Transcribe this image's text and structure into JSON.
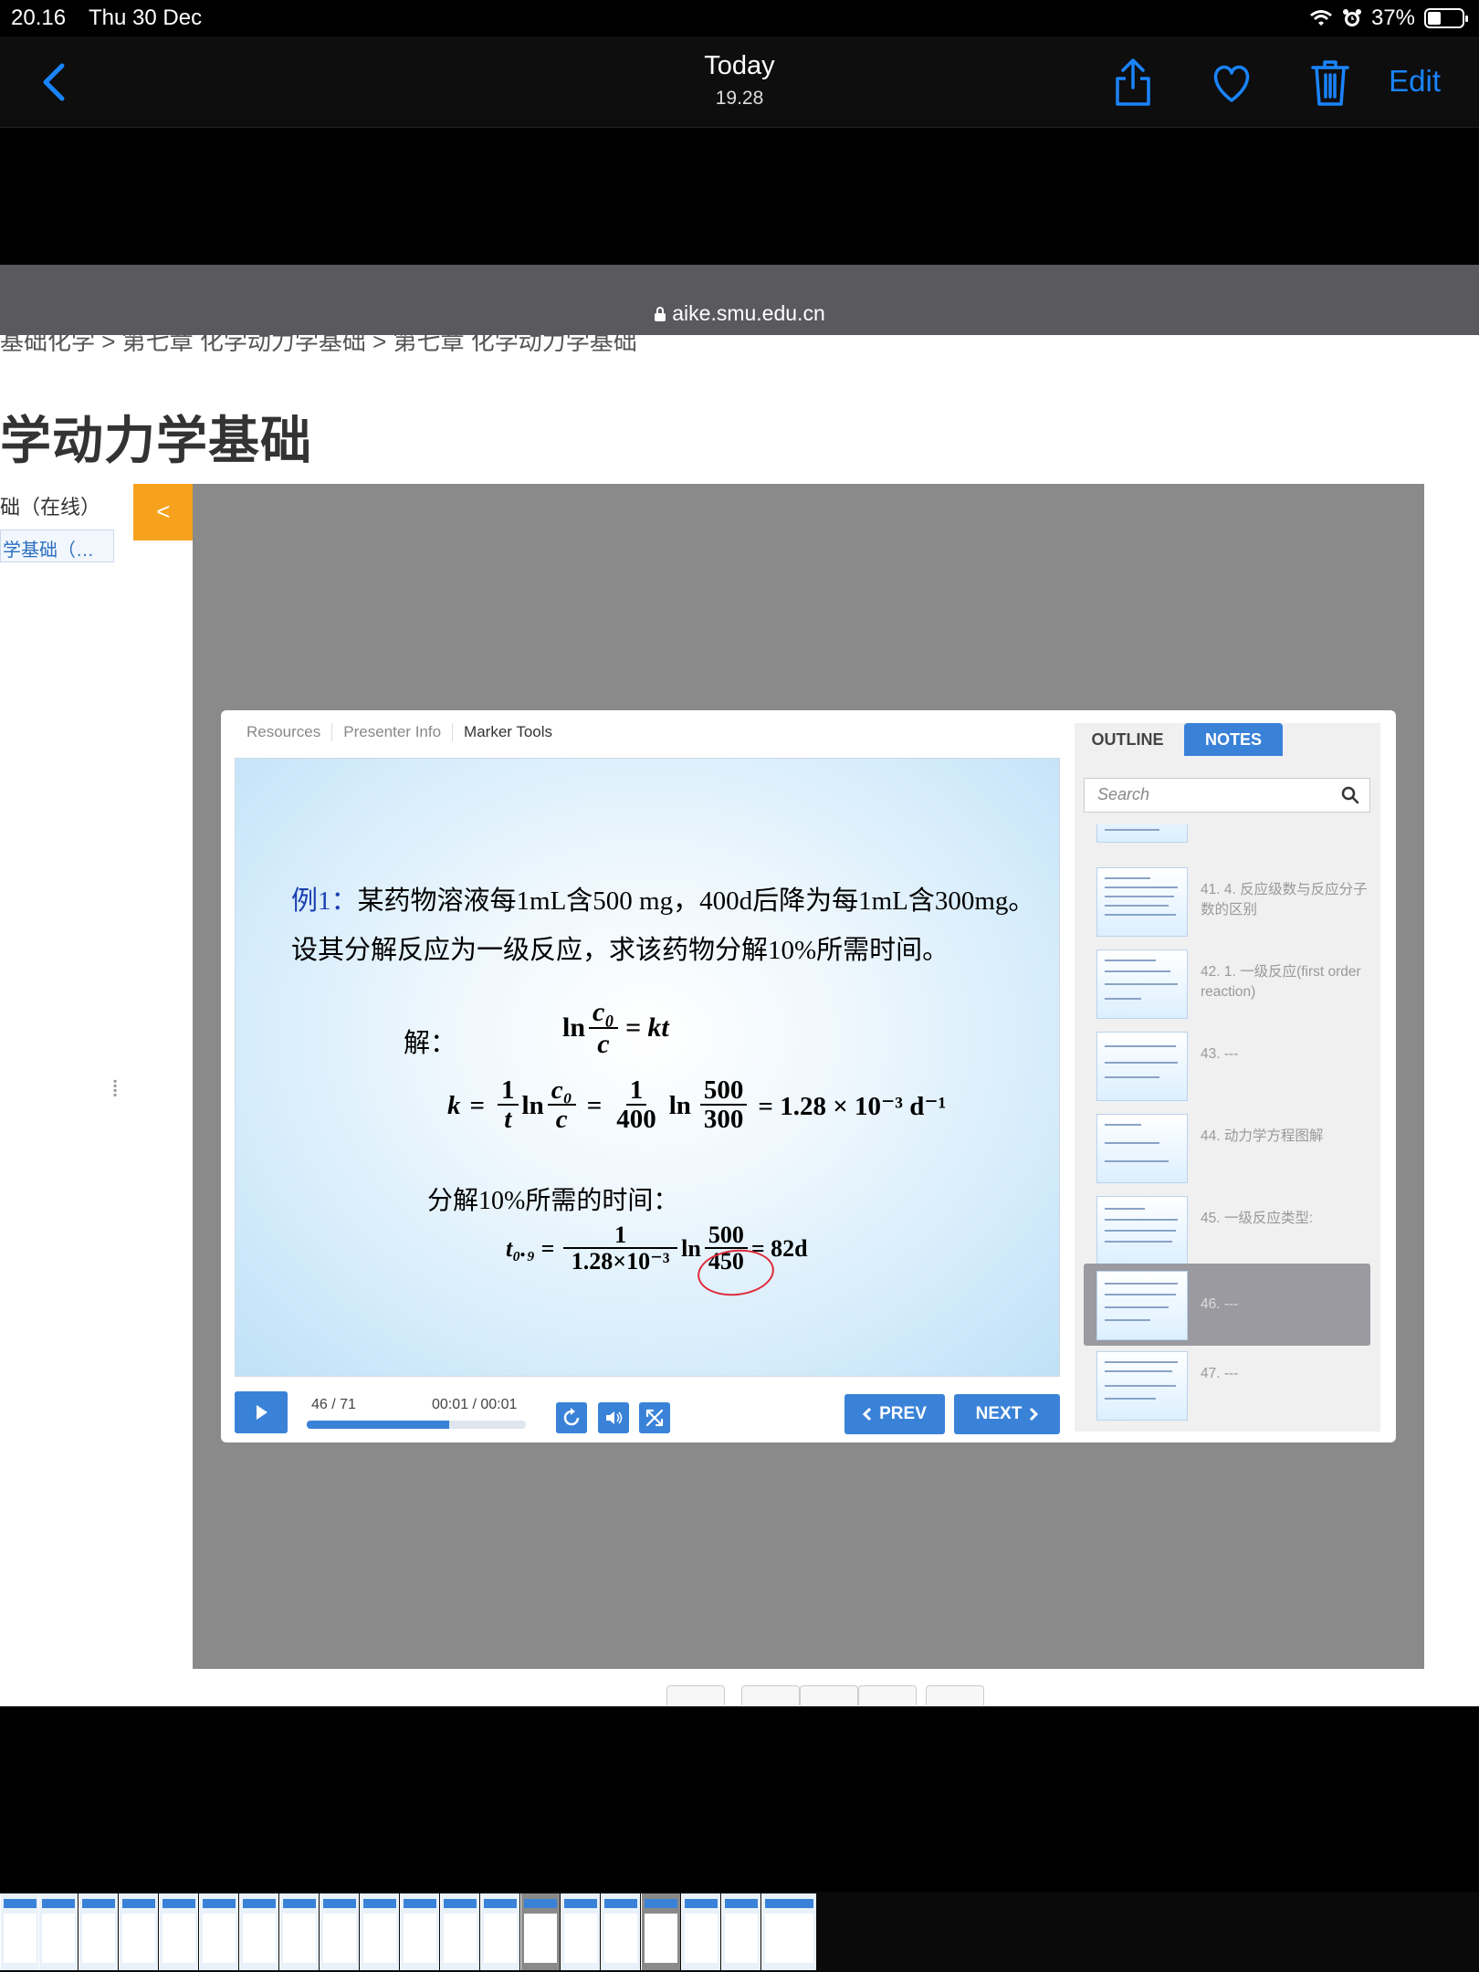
{
  "status": {
    "time": "20.16",
    "date": "Thu 30 Dec",
    "battery": "37%",
    "battery_level": 0.37
  },
  "header": {
    "title": "Today",
    "subtitle": "19.28",
    "edit_label": "Edit"
  },
  "browser": {
    "url": "aike.smu.edu.cn"
  },
  "course": {
    "breadcrumb": "基础化学  >  第七章 化学动力学基础  >  第七章 化学动力学基础",
    "title": "学动力学基础",
    "side_label": "础（在线）",
    "side_link": "学基础（…",
    "collapse_label": "<"
  },
  "player": {
    "tabs": [
      "Resources",
      "Presenter Info",
      "Marker Tools"
    ],
    "progress_text": "46 / 71",
    "time_text": "00:01 / 00:01",
    "progress": 0.648,
    "prev_label": "PREV",
    "next_label": "NEXT",
    "side_tabs": {
      "outline": "OUTLINE",
      "notes": "NOTES"
    },
    "search_placeholder": "Search",
    "outline": [
      {
        "label": "41. 4. 反应级数与反应分子数的区别",
        "active": false
      },
      {
        "label": "42. 1. 一级反应(first order reaction)",
        "active": false
      },
      {
        "label": "43. ---",
        "active": false
      },
      {
        "label": "44. 动力学方程图解",
        "active": false
      },
      {
        "label": "45. 一级反应类型:",
        "active": false
      },
      {
        "label": "46. ---",
        "active": true
      },
      {
        "label": "47. ---",
        "active": false
      }
    ]
  },
  "slide": {
    "example_label": "例1：",
    "line1": "某药物溶液每1mL含500 mg，400d后降为每1mL含300mg。",
    "line2": "设其分解反应为一级反应，求该药物分解10%所需时间。",
    "solve_label": "解：",
    "eq1": {
      "ln": "ln",
      "num": "c₀",
      "den": "c",
      "rhs": "= kt"
    },
    "eq2": {
      "k": "k",
      "eq": "=",
      "one": "1",
      "t": "t",
      "ln": "ln",
      "c0": "c₀",
      "c": "c",
      "n1": "1",
      "d1": "400",
      "n2": "500",
      "d2": "300",
      "result": "= 1.28 × 10⁻³ d⁻¹"
    },
    "time_label": "分解10%所需的时间：",
    "eq3": {
      "lhs": "t₀.₉ =",
      "num": "1",
      "den": "1.28×10⁻³",
      "ln": "ln",
      "n2": "500",
      "d2": "450",
      "result": "= 82d"
    }
  },
  "colors": {
    "accent": "#3a82d8",
    "ios_blue": "#1a84ff",
    "orange": "#f6a21d",
    "marker_red": "#e02a3a"
  }
}
